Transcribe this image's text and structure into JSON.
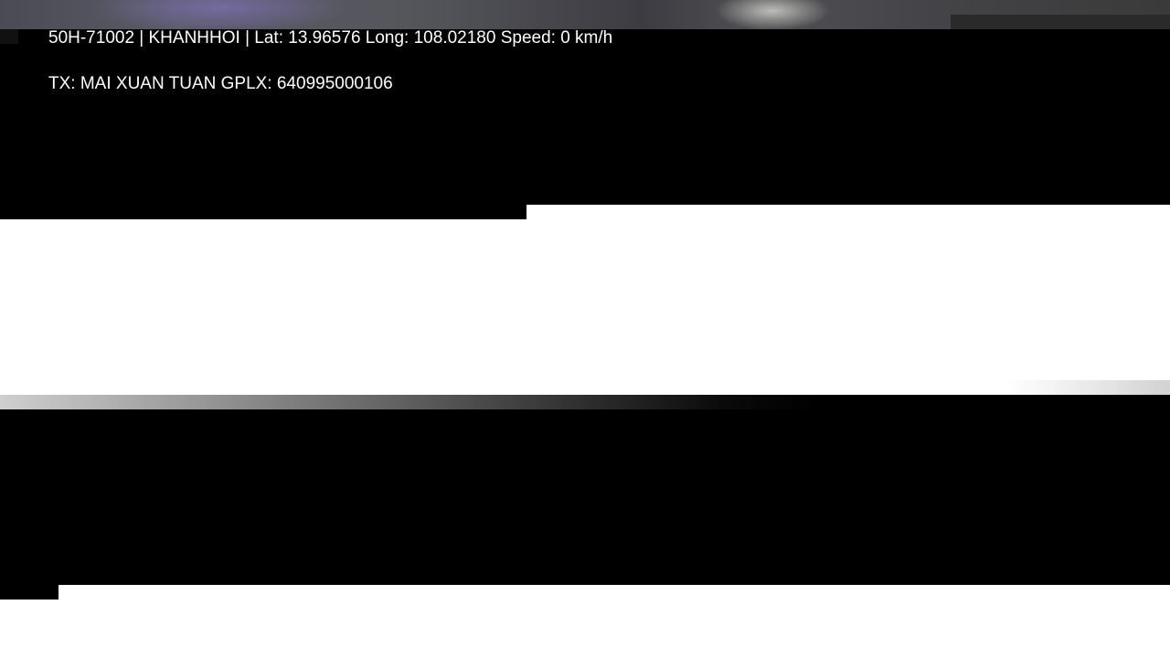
{
  "overlay": {
    "vehicle_line": "50H-71002 | KHANHHOI | Lat: 13.96576 Long: 108.02180 Speed: 0 km/h",
    "driver_line": "TX: MAI XUAN TUAN GPLX: 640995000106"
  },
  "colors": {
    "overlay_text": "#ffffff",
    "bands": "#000000",
    "background": "#ffffff"
  }
}
